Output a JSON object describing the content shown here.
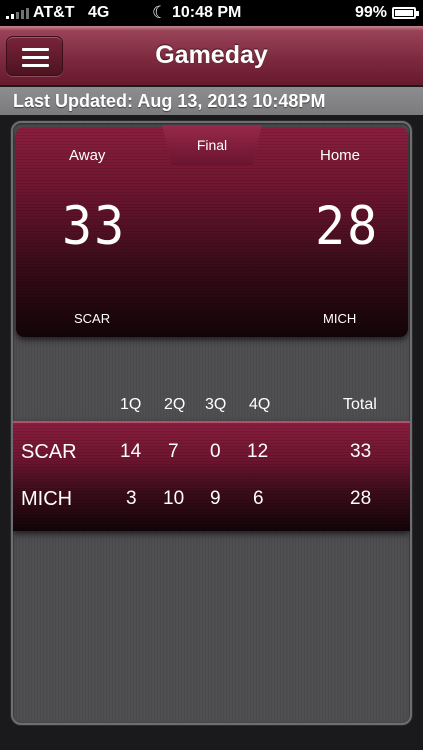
{
  "status_bar": {
    "carrier": "AT&T",
    "network": "4G",
    "time": "10:48 PM",
    "battery": "99%",
    "battery_level": 0.99,
    "icons": [
      "signal-icon",
      "moon-icon",
      "battery-icon"
    ]
  },
  "nav": {
    "title": "Gameday",
    "menu_icon": "hamburger-icon"
  },
  "last_updated": "Last Updated: Aug 13, 2013 10:48PM",
  "scoreboard": {
    "status": "Final",
    "away": {
      "side_label": "Away",
      "score": "33",
      "team": "SCAR"
    },
    "home": {
      "side_label": "Home",
      "score": "28",
      "team": "MICH"
    }
  },
  "line_score": {
    "headers": [
      "1Q",
      "2Q",
      "3Q",
      "4Q",
      "Total"
    ],
    "rows": [
      {
        "team": "SCAR",
        "q1": "14",
        "q2": "7",
        "q3": "0",
        "q4": "12",
        "total": "33"
      },
      {
        "team": "MICH",
        "q1": "3",
        "q2": "10",
        "q3": "9",
        "q4": "6",
        "total": "28"
      }
    ]
  },
  "colors": {
    "accent": "#7d2a3f",
    "panel": "#4d4d50"
  }
}
